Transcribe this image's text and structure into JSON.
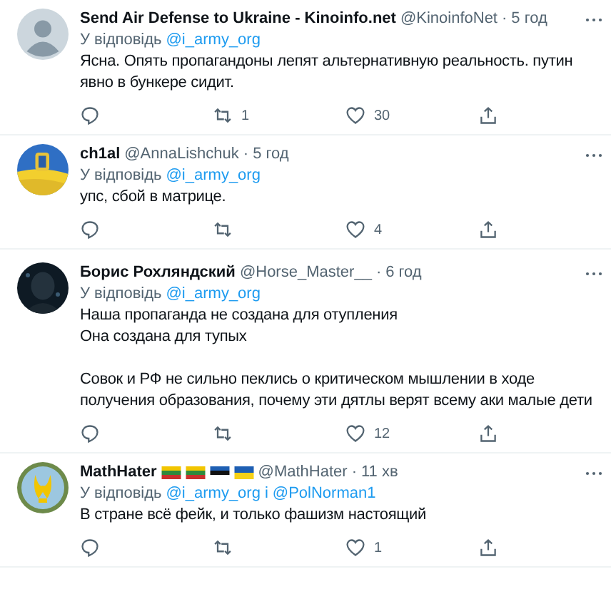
{
  "tweets": [
    {
      "avatar": {
        "kind": "default"
      },
      "name": "Send Air Defense to Ukraine - Kinoinfo.net",
      "handle": "@KinoinfoNet",
      "separator": "·",
      "time": "5 год",
      "reply": {
        "label": "У відповідь",
        "mentions": [
          "@i_army_org"
        ]
      },
      "paragraphs": [
        "Ясна. Опять пропагандоны лепят альтернативную реальность. путин явно в бункере сидит."
      ],
      "retweets": "1",
      "likes": "30"
    },
    {
      "avatar": {
        "kind": "flag"
      },
      "name": "ch1al",
      "handle": "@AnnaLishchuk",
      "separator": "·",
      "time": "5 год",
      "reply": {
        "label": "У відповідь",
        "mentions": [
          "@i_army_org"
        ]
      },
      "paragraphs": [
        "упс, сбой в матрице."
      ],
      "likes": "4"
    },
    {
      "avatar": {
        "kind": "dark"
      },
      "name": "Борис Рохляндский",
      "handle": "@Horse_Master__",
      "separator": "·",
      "time": "6 год",
      "reply": {
        "label": "У відповідь",
        "mentions": [
          "@i_army_org"
        ]
      },
      "paragraphs": [
        "Наша пропаганда не создана для отупления",
        "Она создана для тупых",
        "Совок и РФ не сильно пеклись о критическом мышлении в ходе получения образования, почему эти дятлы верят всему аки малые дети"
      ],
      "likes": "12"
    },
    {
      "avatar": {
        "kind": "emblem"
      },
      "name": "MathHater",
      "flags": [
        {
          "kind": "lithuania"
        },
        {
          "kind": "lithuania"
        },
        {
          "kind": "estonia"
        },
        {
          "kind": "ukraine"
        }
      ],
      "handle": "@MathHater",
      "separator": "·",
      "time": "11 хв",
      "reply": {
        "label": "У відповідь",
        "mentions": [
          "@i_army_org",
          "@PolNorman1"
        ],
        "joiner": "і"
      },
      "paragraphs": [
        "В стране всё фейк, и только фашизм настоящий"
      ],
      "likes": "1"
    }
  ]
}
